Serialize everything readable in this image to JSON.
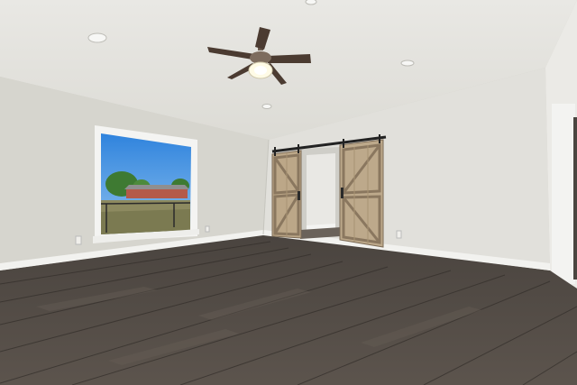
{
  "scene": {
    "colors": {
      "ceiling": "#e4e3de",
      "wall_left": "#d9d8d2",
      "wall_right": "#e2e1dc",
      "floor_dark": "#3b3632",
      "floor_mid": "#5a524b",
      "baseboard": "#f1f1ee",
      "barn_wood": "#b9a58a",
      "barn_wood_dark": "#8d7a62",
      "door_track": "#2a2a2a",
      "sky": "#3f8fe0",
      "grass": "#8c8a5f",
      "fan_blade": "#4a3a30"
    },
    "elements": {
      "ceiling_fan": "ceiling-fan-with-light",
      "window": "picture-window",
      "barn_doors": "sliding-barn-doors",
      "recessed_lights": "recessed-lights",
      "floor": "dark-wood-plank-floor"
    }
  }
}
